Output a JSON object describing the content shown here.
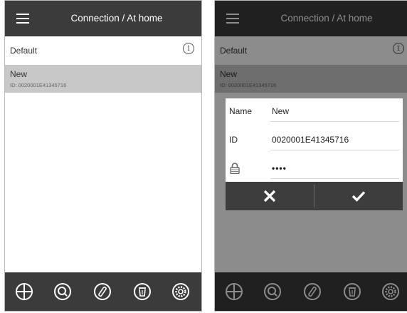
{
  "app": {
    "title": "Connection / At home"
  },
  "list": {
    "items": [
      {
        "name": "Default"
      },
      {
        "name": "New",
        "id_text": "ID: 0020001E41345716"
      }
    ]
  },
  "toolbar": {
    "icons": [
      "add-icon",
      "search-icon",
      "edit-icon",
      "delete-icon",
      "settings-icon"
    ]
  },
  "dialog": {
    "name_label": "Name",
    "name_value": "New",
    "id_label": "ID",
    "id_value": "0020001E41345716",
    "password_value": "••••",
    "cancel_icon": "close-icon",
    "ok_icon": "check-icon"
  },
  "colors": {
    "header": "#3b3b3b",
    "selected_row": "#c8c8c8",
    "toolbar": "#3b3b3b",
    "overlay": "rgba(0,0,0,0.45)"
  }
}
